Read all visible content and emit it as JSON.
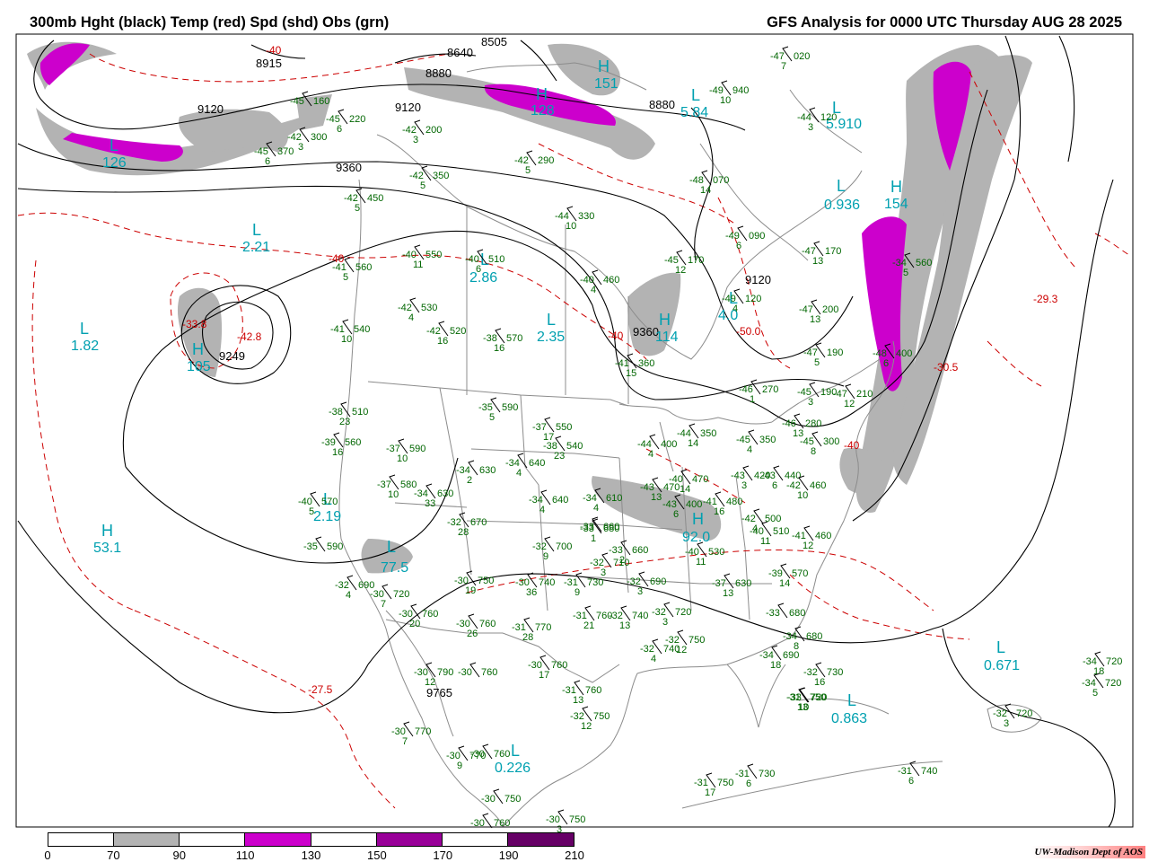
{
  "header": {
    "left_title": "300mb Hght (black) Temp (red) Spd (shd) Obs (grn)",
    "right_title": "GFS Analysis for 0000 UTC Thursday  AUG 28 2025"
  },
  "legend": {
    "labels": [
      "0",
      "70",
      "90",
      "110",
      "130",
      "150",
      "170",
      "190",
      "210"
    ],
    "segments": [
      {
        "color": "#ffffff"
      },
      {
        "color": "#b3b3b3"
      },
      {
        "color": "#ffffff"
      },
      {
        "color": "#cc00cc"
      },
      {
        "color": "#ffffff"
      },
      {
        "color": "#990099"
      },
      {
        "color": "#ffffff"
      },
      {
        "color": "#660066"
      }
    ]
  },
  "credit": "UW-Madison   Dept of AOS",
  "colors": {
    "height_contour": "#000000",
    "temp_contour": "#cc0000",
    "obs": "#006600",
    "speed_labels": "#00a0b0",
    "speed_70_90": "#b3b3b3",
    "speed_110_130": "#cc00cc",
    "geography": "#8c8c8c"
  },
  "height_labels": [
    "8915",
    "8640",
    "8505",
    "8880",
    "9120",
    "9120",
    "9360",
    "8880",
    "9120",
    "9360",
    "9249",
    "9765"
  ],
  "temp_labels": [
    "-40",
    "-40",
    "-33.8",
    "-42.8",
    "-50.0",
    "-29.3",
    "-30.5",
    "-27.5",
    "-40",
    "-40"
  ],
  "centers": [
    {
      "type": "L",
      "value": "2.21"
    },
    {
      "type": "L",
      "value": "1.82"
    },
    {
      "type": "H",
      "value": "53.1"
    },
    {
      "type": "H",
      "value": "105"
    },
    {
      "type": "L",
      "value": "2.86"
    },
    {
      "type": "L",
      "value": "2.35"
    },
    {
      "type": "H",
      "value": "114"
    },
    {
      "type": "L",
      "value": "4.0"
    },
    {
      "type": "L",
      "value": "0.936"
    },
    {
      "type": "L",
      "value": "2.19"
    },
    {
      "type": "L",
      "value": "77.5"
    },
    {
      "type": "H",
      "value": "92.0"
    },
    {
      "type": "L",
      "value": "0.671"
    },
    {
      "type": "L",
      "value": "0.863"
    },
    {
      "type": "L",
      "value": "0.226"
    },
    {
      "type": "H",
      "value": "128"
    },
    {
      "type": "L",
      "value": "5.84"
    },
    {
      "type": "L",
      "value": "5.910"
    },
    {
      "type": "H",
      "value": "154"
    },
    {
      "type": "H",
      "value": "151"
    },
    {
      "type": "L",
      "value": "126"
    }
  ],
  "observations": [
    {
      "t": "-45",
      "h": "160",
      "d": ""
    },
    {
      "t": "-45",
      "h": "220",
      "d": "6"
    },
    {
      "t": "-42",
      "h": "300",
      "d": "3"
    },
    {
      "t": "-45",
      "h": "370",
      "d": "6"
    },
    {
      "t": "-42",
      "h": "200",
      "d": "3"
    },
    {
      "t": "-42",
      "h": "350",
      "d": "5"
    },
    {
      "t": "-42",
      "h": "290",
      "d": "5"
    },
    {
      "t": "-42",
      "h": "450",
      "d": "5"
    },
    {
      "t": "-44",
      "h": "330",
      "d": "10"
    },
    {
      "t": "-40",
      "h": "550",
      "d": "11"
    },
    {
      "t": "-40",
      "h": "510",
      "d": "6"
    },
    {
      "t": "-40",
      "h": "460",
      "d": "4"
    },
    {
      "t": "-41",
      "h": "560",
      "d": "5"
    },
    {
      "t": "-42",
      "h": "530",
      "d": "4"
    },
    {
      "t": "-41",
      "h": "540",
      "d": "10"
    },
    {
      "t": "-42",
      "h": "520",
      "d": "16"
    },
    {
      "t": "-38",
      "h": "570",
      "d": "16"
    },
    {
      "t": "-41",
      "h": "360",
      "d": "15"
    },
    {
      "t": "-47",
      "h": "020",
      "d": "7"
    },
    {
      "t": "-49",
      "h": "940",
      "d": "10"
    },
    {
      "t": "-44",
      "h": "120",
      "d": "3"
    },
    {
      "t": "-48",
      "h": "070",
      "d": "14"
    },
    {
      "t": "-49",
      "h": "090",
      "d": "6"
    },
    {
      "t": "-45",
      "h": "170",
      "d": "12"
    },
    {
      "t": "-47",
      "h": "170",
      "d": "13"
    },
    {
      "t": "-49",
      "h": "120",
      "d": "4"
    },
    {
      "t": "-47",
      "h": "200",
      "d": "13"
    },
    {
      "t": "-47",
      "h": "190",
      "d": "5"
    },
    {
      "t": "-34",
      "h": "560",
      "d": "5"
    },
    {
      "t": "-38",
      "h": "510",
      "d": "23"
    },
    {
      "t": "-39",
      "h": "560",
      "d": "16"
    },
    {
      "t": "-37",
      "h": "590",
      "d": "10"
    },
    {
      "t": "-35",
      "h": "590",
      "d": "5"
    },
    {
      "t": "-37",
      "h": "550",
      "d": "17"
    },
    {
      "t": "-38",
      "h": "540",
      "d": "23"
    },
    {
      "t": "-34",
      "h": "640",
      "d": "4"
    },
    {
      "t": "-34",
      "h": "630",
      "d": "2"
    },
    {
      "t": "-37",
      "h": "580",
      "d": "10"
    },
    {
      "t": "-34",
      "h": "630",
      "d": "33"
    },
    {
      "t": "-40",
      "h": "570",
      "d": "5"
    },
    {
      "t": "-35",
      "h": "590",
      "d": ""
    },
    {
      "t": "-32",
      "h": "670",
      "d": "28"
    },
    {
      "t": "-33",
      "h": "660",
      "d": ""
    },
    {
      "t": "-32",
      "h": "690",
      "d": "4"
    },
    {
      "t": "-30",
      "h": "720",
      "d": "7"
    },
    {
      "t": "-30",
      "h": "760",
      "d": "20"
    },
    {
      "t": "-30",
      "h": "750",
      "d": "19"
    },
    {
      "t": "-30",
      "h": "740",
      "d": "36"
    },
    {
      "t": "-31",
      "h": "730",
      "d": "9"
    },
    {
      "t": "-32",
      "h": "710",
      "d": "3"
    },
    {
      "t": "-32",
      "h": "700",
      "d": "9"
    },
    {
      "t": "-33",
      "h": "680",
      "d": "1"
    },
    {
      "t": "-33",
      "h": "660",
      "d": "2"
    },
    {
      "t": "-34",
      "h": "610",
      "d": "4"
    },
    {
      "t": "-34",
      "h": "640",
      "d": "4"
    },
    {
      "t": "-30",
      "h": "760",
      "d": "26"
    },
    {
      "t": "-31",
      "h": "770",
      "d": "28"
    },
    {
      "t": "-31",
      "h": "760",
      "d": "21"
    },
    {
      "t": "-32",
      "h": "740",
      "d": "13"
    },
    {
      "t": "-32",
      "h": "690",
      "d": "3"
    },
    {
      "t": "-32",
      "h": "720",
      "d": "3"
    },
    {
      "t": "-32",
      "h": "740",
      "d": "4"
    },
    {
      "t": "-32",
      "h": "750",
      "d": "12"
    },
    {
      "t": "-30",
      "h": "790",
      "d": "12"
    },
    {
      "t": "-30",
      "h": "760",
      "d": ""
    },
    {
      "t": "-30",
      "h": "760",
      "d": "17"
    },
    {
      "t": "-31",
      "h": "760",
      "d": "13"
    },
    {
      "t": "-32",
      "h": "750",
      "d": "12"
    },
    {
      "t": "-30",
      "h": "770",
      "d": "7"
    },
    {
      "t": "-30",
      "h": "770",
      "d": "9"
    },
    {
      "t": "-30",
      "h": "760",
      "d": ""
    },
    {
      "t": "-30",
      "h": "750",
      "d": ""
    },
    {
      "t": "-30",
      "h": "760",
      "d": ""
    },
    {
      "t": "-30",
      "h": "750",
      "d": "3"
    },
    {
      "t": "-31",
      "h": "750",
      "d": "17"
    },
    {
      "t": "-31",
      "h": "730",
      "d": "6"
    },
    {
      "t": "-31",
      "h": "740",
      "d": "6"
    },
    {
      "t": "-31",
      "h": "750",
      "d": "13"
    },
    {
      "t": "-32",
      "h": "730",
      "d": "16"
    },
    {
      "t": "-33",
      "h": "720",
      "d": "10"
    },
    {
      "t": "-34",
      "h": "690",
      "d": "18"
    },
    {
      "t": "-34",
      "h": "680",
      "d": "8"
    },
    {
      "t": "-33",
      "h": "680",
      "d": ""
    },
    {
      "t": "-37",
      "h": "630",
      "d": "13"
    },
    {
      "t": "-40",
      "h": "530",
      "d": "11"
    },
    {
      "t": "-39",
      "h": "570",
      "d": "14"
    },
    {
      "t": "-40",
      "h": "510",
      "d": "11"
    },
    {
      "t": "-41",
      "h": "460",
      "d": "12"
    },
    {
      "t": "-42",
      "h": "500",
      "d": "4"
    },
    {
      "t": "-41",
      "h": "480",
      "d": "16"
    },
    {
      "t": "-40",
      "h": "470",
      "d": "14"
    },
    {
      "t": "-43",
      "h": "470",
      "d": "13"
    },
    {
      "t": "-43",
      "h": "400",
      "d": "6"
    },
    {
      "t": "-44",
      "h": "400",
      "d": "4"
    },
    {
      "t": "-44",
      "h": "350",
      "d": "14"
    },
    {
      "t": "-43",
      "h": "420",
      "d": "3"
    },
    {
      "t": "-43",
      "h": "440",
      "d": "6"
    },
    {
      "t": "-42",
      "h": "460",
      "d": "10"
    },
    {
      "t": "-45",
      "h": "350",
      "d": "4"
    },
    {
      "t": "-46",
      "h": "280",
      "d": "13"
    },
    {
      "t": "-45",
      "h": "300",
      "d": "8"
    },
    {
      "t": "-46",
      "h": "270",
      "d": "1"
    },
    {
      "t": "-45",
      "h": "190",
      "d": "3"
    },
    {
      "t": "-47",
      "h": "210",
      "d": "12"
    },
    {
      "t": "-48",
      "h": "400",
      "d": "6"
    },
    {
      "t": "-34",
      "h": "720",
      "d": "18"
    },
    {
      "t": "-34",
      "h": "720",
      "d": "5"
    },
    {
      "t": "-32",
      "h": "720",
      "d": "3"
    }
  ]
}
